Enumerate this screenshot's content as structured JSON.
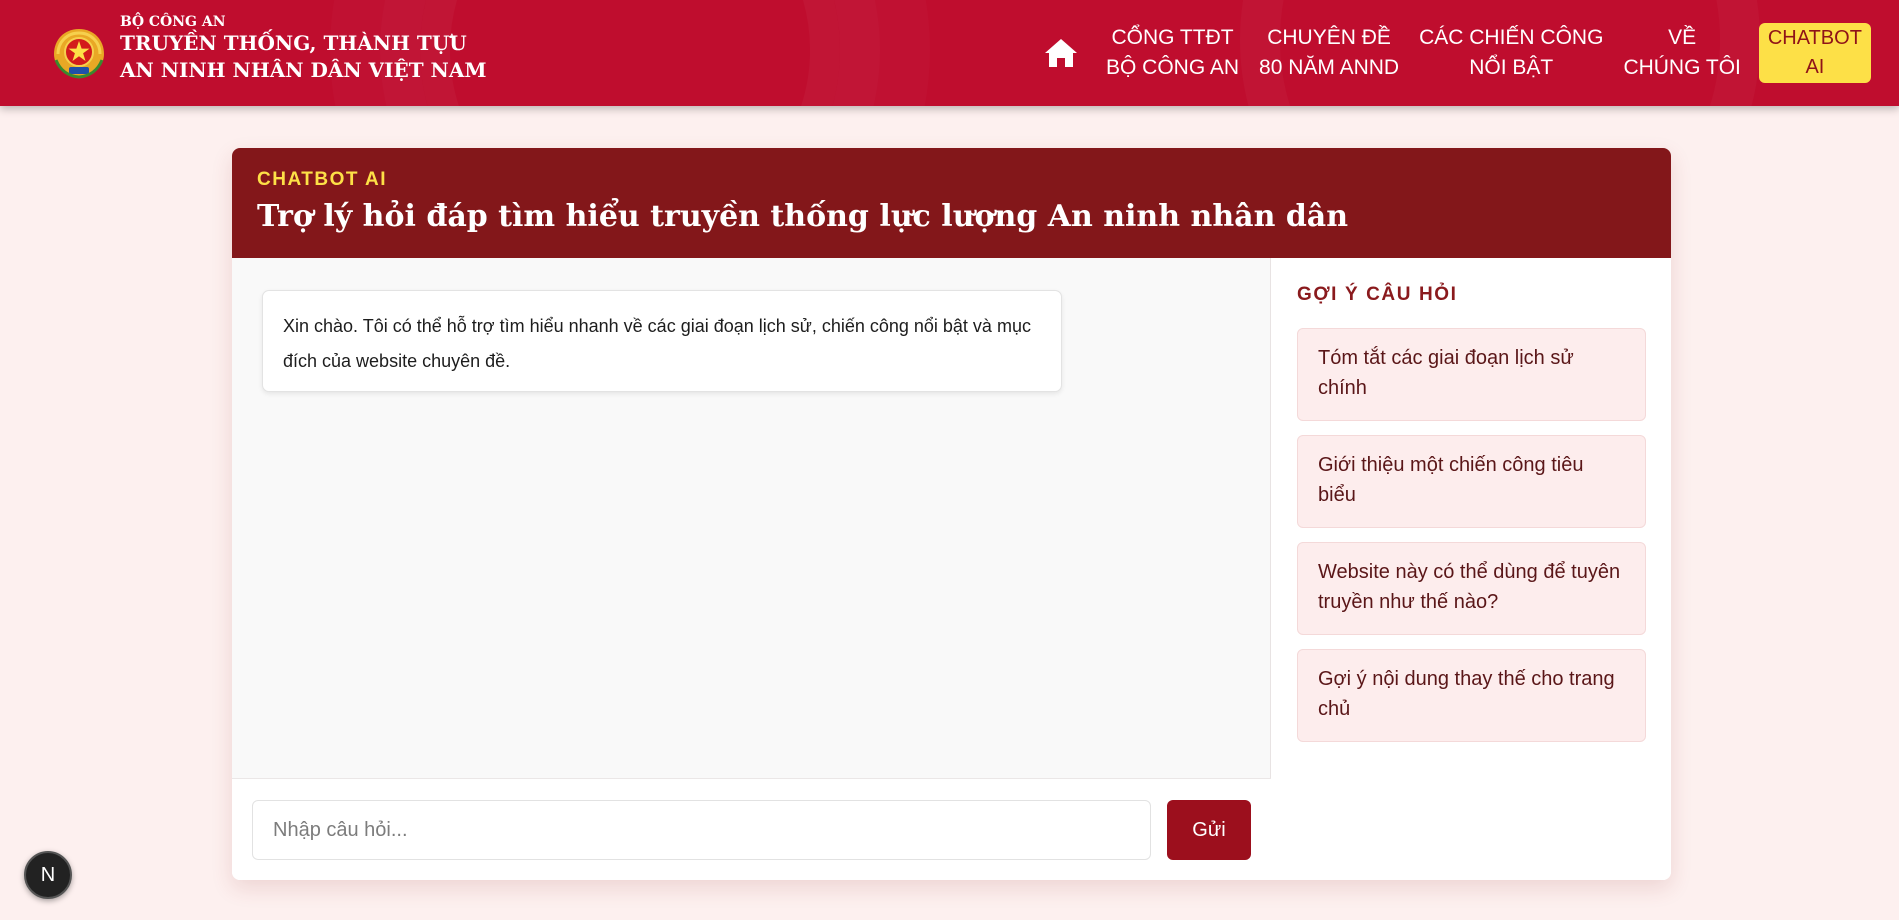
{
  "header": {
    "brand_small": "BỘ CÔNG AN",
    "brand_line1": "TRUYỀN THỐNG, THÀNH TỰU",
    "brand_line2": "AN NINH NHÂN DÂN VIỆT NAM",
    "home_icon": "home-icon",
    "nav": [
      {
        "line1": "CỔNG TTĐT",
        "line2": "BỘ CÔNG AN"
      },
      {
        "line1": "CHUYÊN ĐỀ",
        "line2": "80 NĂM ANND"
      },
      {
        "line1": "CÁC CHIẾN CÔNG",
        "line2": "NỔI BẬT"
      },
      {
        "line1": "VỀ",
        "line2": "CHÚNG TÔI"
      }
    ],
    "cta": {
      "line1": "CHATBOT",
      "line2": "AI"
    }
  },
  "card": {
    "eyebrow": "CHATBOT AI",
    "title": "Trợ lý hỏi đáp tìm hiểu truyền thống lực lượng An ninh nhân dân",
    "bot_message": "Xin chào. Tôi có thể hỗ trợ tìm hiểu nhanh về các giai đoạn lịch sử, chiến công nổi bật và mục đích của website chuyên đề.",
    "input_placeholder": "Nhập câu hỏi...",
    "send_label": "Gửi"
  },
  "suggestions": {
    "title": "GỢI Ý CÂU HỎI",
    "items": [
      "Tóm tắt các giai đoạn lịch sử chính",
      "Giới thiệu một chiến công tiêu biểu",
      "Website này có thể dùng để tuyên truyền như thế nào?",
      "Gợi ý nội dung thay thế cho trang chủ"
    ]
  },
  "badge": {
    "letter": "N"
  },
  "colors": {
    "header_red": "#bf0d2e",
    "card_head": "#83171a",
    "accent_yellow": "#fde047",
    "send_button": "#9c0f1d",
    "page_bg": "#fdf0ef"
  }
}
